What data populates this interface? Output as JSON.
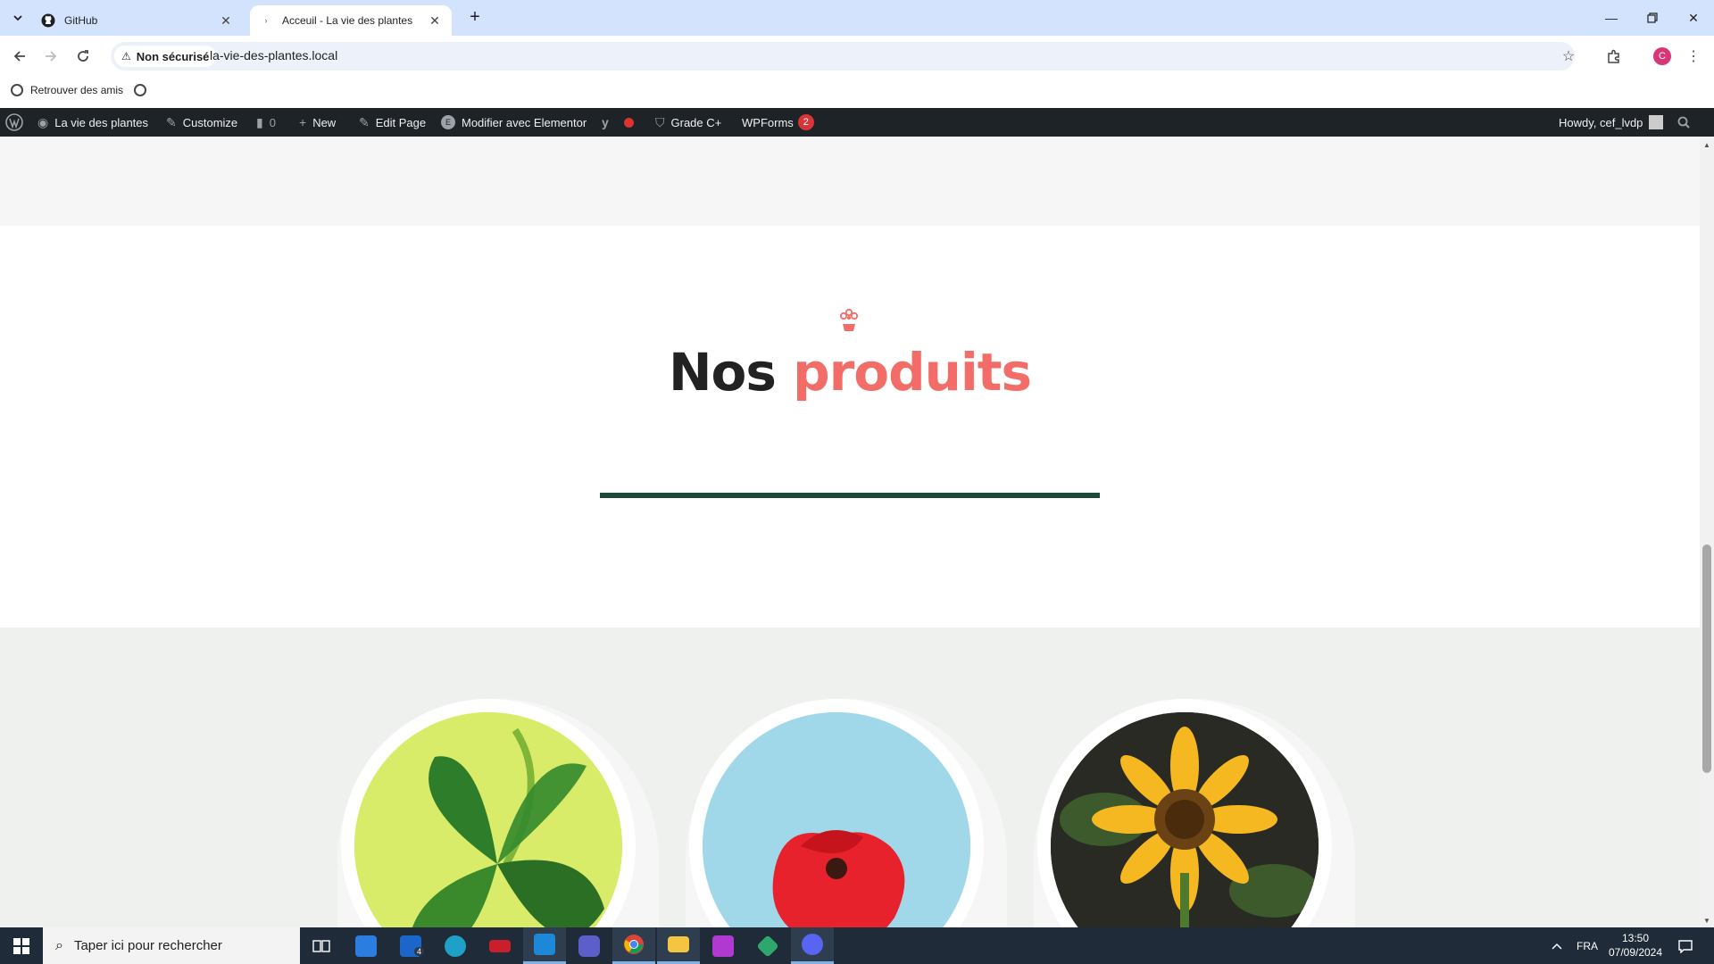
{
  "browser": {
    "tabs": [
      {
        "title": "GitHub",
        "active": false
      },
      {
        "title": "Acceuil - La vie des plantes",
        "active": true
      }
    ],
    "security_label": "Non sécurisé",
    "url": "la-vie-des-plantes.local",
    "profile_initial": "C",
    "bookmarks": [
      {
        "label": "Retrouver des amis"
      }
    ]
  },
  "admin_bar": {
    "site_name": "La vie des plantes",
    "customize": "Customize",
    "comments_count": "0",
    "new": "New",
    "edit_page": "Edit Page",
    "elementor": "Modifier avec Elementor",
    "grade": "Grade C+",
    "wpforms": "WPForms",
    "wpforms_count": "2",
    "howdy": "Howdy, cef_lvdp"
  },
  "section": {
    "heading_main": "Nos",
    "heading_accent": "produits",
    "accent_color": "#f26d68",
    "divider_color": "#1c4a3a"
  },
  "products": [
    {
      "image": "four-leaf-clover",
      "background": "#d8ec6a"
    },
    {
      "image": "red-poppy",
      "background": "#a0d8ea"
    },
    {
      "image": "sunflower",
      "background": "#2a2a24"
    }
  ],
  "taskbar": {
    "search_placeholder": "Taper ici pour rechercher",
    "mail_badge": "4",
    "language": "FRA",
    "time": "13:50",
    "date": "07/09/2024"
  }
}
